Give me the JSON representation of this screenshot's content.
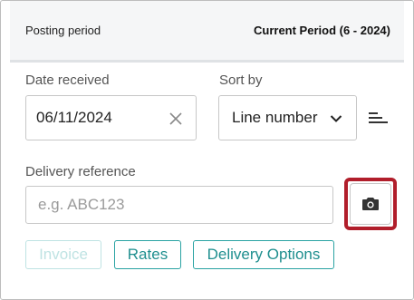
{
  "header": {
    "label": "Posting period",
    "value": "Current Period (6 - 2024)"
  },
  "date_received": {
    "label": "Date received",
    "value": "06/11/2024"
  },
  "sort_by": {
    "label": "Sort by",
    "value": "Line number"
  },
  "delivery_reference": {
    "label": "Delivery reference",
    "placeholder": "e.g. ABC123"
  },
  "buttons": {
    "invoice": "Invoice",
    "rates": "Rates",
    "delivery_options": "Delivery Options"
  },
  "icons": {
    "clear": "close-icon",
    "dropdown": "chevron-down-icon",
    "sort_order": "sort-lines-icon",
    "camera": "camera-icon"
  },
  "colors": {
    "accent": "#2aa3a3",
    "highlight": "#b11e2b"
  }
}
